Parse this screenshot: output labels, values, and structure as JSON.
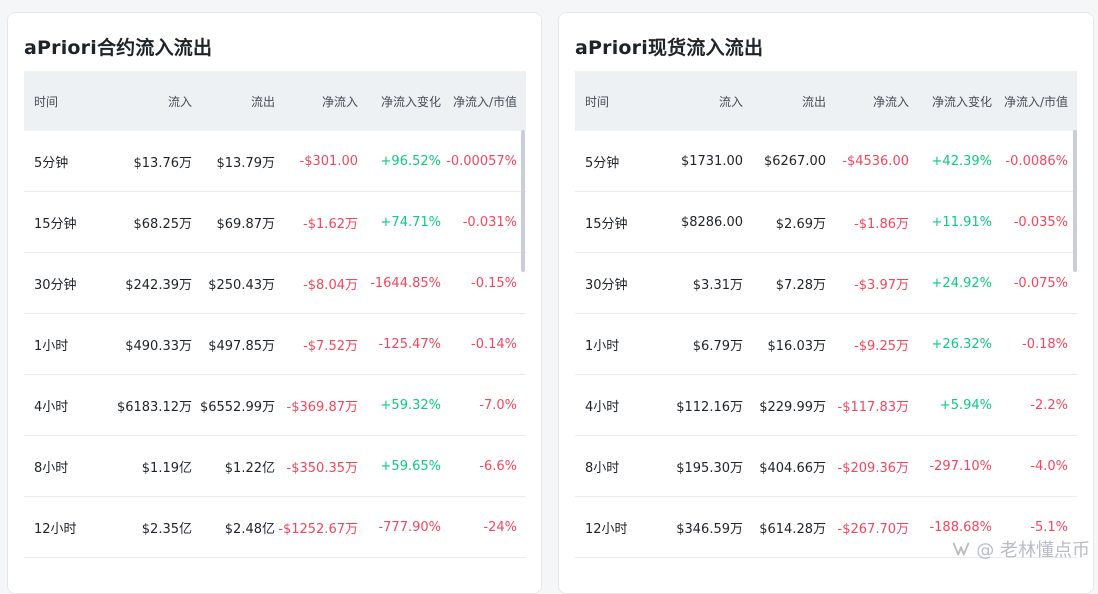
{
  "colors": {
    "negative": "#f6465d",
    "positive": "#0ecb81"
  },
  "left": {
    "title": "aPriori合约流入流出",
    "headers": [
      "时间",
      "流入",
      "流出",
      "净流入",
      "净流入变化",
      "净流入/市值"
    ],
    "rows": [
      [
        "5分钟",
        "$13.76万",
        "$13.79万",
        "-$301.00",
        "+96.52%",
        "-0.00057%"
      ],
      [
        "15分钟",
        "$68.25万",
        "$69.87万",
        "-$1.62万",
        "+74.71%",
        "-0.031%"
      ],
      [
        "30分钟",
        "$242.39万",
        "$250.43万",
        "-$8.04万",
        "-1644.85%",
        "-0.15%"
      ],
      [
        "1小时",
        "$490.33万",
        "$497.85万",
        "-$7.52万",
        "-125.47%",
        "-0.14%"
      ],
      [
        "4小时",
        "$6183.12万",
        "$6552.99万",
        "-$369.87万",
        "+59.32%",
        "-7.0%"
      ],
      [
        "8小时",
        "$1.19亿",
        "$1.22亿",
        "-$350.35万",
        "+59.65%",
        "-6.6%"
      ],
      [
        "12小时",
        "$2.35亿",
        "$2.48亿",
        "-$1252.67万",
        "-777.90%",
        "-24%"
      ]
    ]
  },
  "right": {
    "title": "aPriori现货流入流出",
    "headers": [
      "时间",
      "流入",
      "流出",
      "净流入",
      "净流入变化",
      "净流入/市值"
    ],
    "rows": [
      [
        "5分钟",
        "$1731.00",
        "$6267.00",
        "-$4536.00",
        "+42.39%",
        "-0.0086%"
      ],
      [
        "15分钟",
        "$8286.00",
        "$2.69万",
        "-$1.86万",
        "+11.91%",
        "-0.035%"
      ],
      [
        "30分钟",
        "$3.31万",
        "$7.28万",
        "-$3.97万",
        "+24.92%",
        "-0.075%"
      ],
      [
        "1小时",
        "$6.79万",
        "$16.03万",
        "-$9.25万",
        "+26.32%",
        "-0.18%"
      ],
      [
        "4小时",
        "$112.16万",
        "$229.99万",
        "-$117.83万",
        "+5.94%",
        "-2.2%"
      ],
      [
        "8小时",
        "$195.30万",
        "$404.66万",
        "-$209.36万",
        "-297.10%",
        "-4.0%"
      ],
      [
        "12小时",
        "$346.59万",
        "$614.28万",
        "-$267.70万",
        "-188.68%",
        "-5.1%"
      ]
    ]
  },
  "watermark": {
    "text": "@ 老林懂点币",
    "icon": "wechat-channels-icon"
  }
}
